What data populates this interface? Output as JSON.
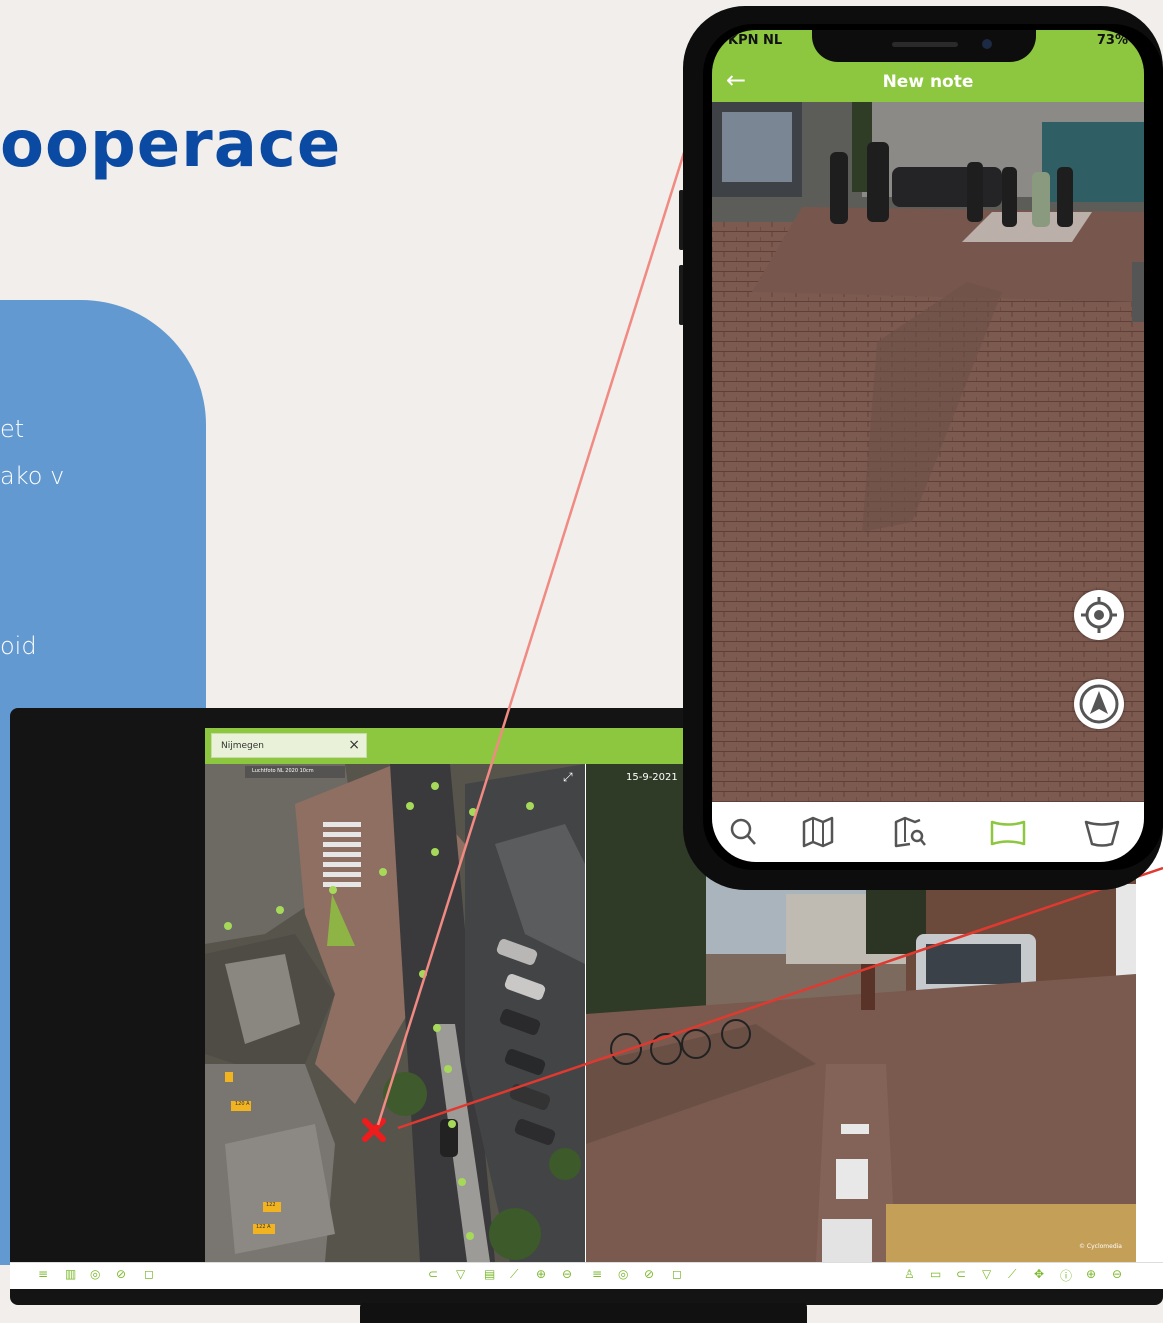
{
  "slide": {
    "title": "ooperace",
    "fragments": [
      "et",
      "ako v",
      "oid"
    ]
  },
  "monitor": {
    "tab_label": "Nijmegen",
    "tab_close": "×",
    "map_layer_label": "Luchtfoto NL 2020 10cm",
    "streetview_date": "15-9-2021",
    "cyclomedia_credit": "© Cyclomedia",
    "address_labels": [
      "120 A",
      "122",
      "122 A"
    ]
  },
  "phone": {
    "carrier": "KPN NL",
    "battery": "73%",
    "back_icon": "←",
    "title": "New note",
    "nav_icons": [
      "search-icon",
      "map-icon",
      "map-search-icon",
      "panorama-icon",
      "oblique-icon"
    ]
  },
  "colors": {
    "brand_green": "#8dc63f",
    "title_blue": "#0b4aa2",
    "panel_blue": "#6399d1",
    "marker_red": "#ee1c1c"
  }
}
